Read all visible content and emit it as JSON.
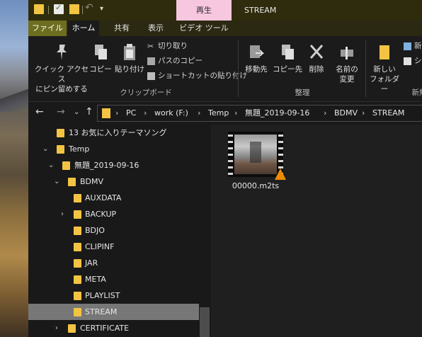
{
  "window": {
    "title": "STREAM",
    "context_tab": "再生"
  },
  "ribbon_tabs": [
    "ファイル",
    "ホーム",
    "共有",
    "表示",
    "ビデオ ツール"
  ],
  "ribbon": {
    "clipboard": {
      "pin_label_1": "クイック アクセス",
      "pin_label_2": "にピン留めする",
      "copy": "コピー",
      "paste": "貼り付け",
      "cut": "切り取り",
      "copy_path": "パスのコピー",
      "paste_shortcut": "ショートカットの貼り付け",
      "group": "クリップボード"
    },
    "organize": {
      "move_to": "移動先",
      "copy_to": "コピー先",
      "delete": "削除",
      "rename_1": "名前の",
      "rename_2": "変更",
      "group": "整理"
    },
    "new": {
      "new_folder_1": "新しい",
      "new_folder_2": "フォルダー",
      "new_item": "新規",
      "easy_access": "ショ",
      "group": "新規"
    }
  },
  "address": {
    "segments": [
      "PC",
      "work (F:)",
      "Temp",
      "無題_2019-09-16",
      "BDMV",
      "STREAM"
    ]
  },
  "tree": [
    {
      "label": "13 お気に入りテーマソング",
      "expander": ""
    },
    {
      "label": "Temp",
      "expander": "⌄"
    },
    {
      "label": "無題_2019-09-16",
      "expander": "⌄"
    },
    {
      "label": "BDMV",
      "expander": "⌄"
    },
    {
      "label": "AUXDATA",
      "expander": ""
    },
    {
      "label": "BACKUP",
      "expander": "›"
    },
    {
      "label": "BDJO",
      "expander": ""
    },
    {
      "label": "CLIPINF",
      "expander": ""
    },
    {
      "label": "JAR",
      "expander": ""
    },
    {
      "label": "META",
      "expander": ""
    },
    {
      "label": "PLAYLIST",
      "expander": ""
    },
    {
      "label": "STREAM",
      "expander": ""
    },
    {
      "label": "CERTIFICATE",
      "expander": "›"
    }
  ],
  "files": [
    {
      "name": "00000.m2ts"
    }
  ]
}
